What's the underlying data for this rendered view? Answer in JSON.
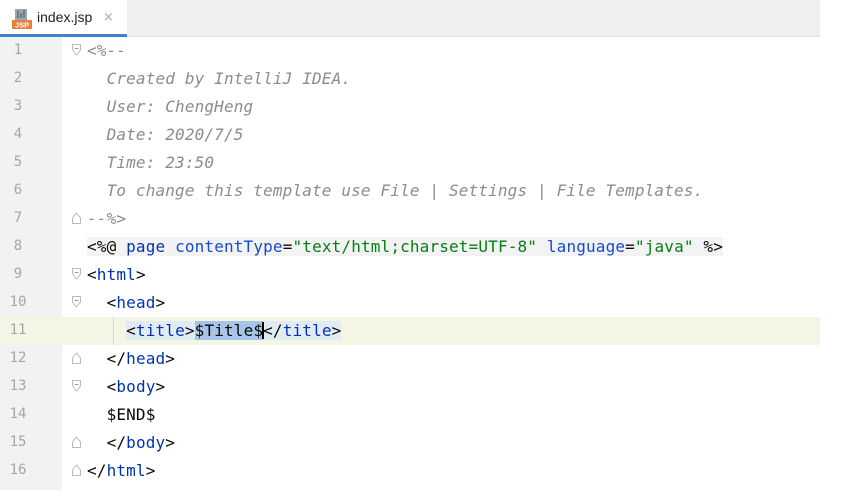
{
  "tab": {
    "file_name": "index.jsp",
    "icon_text": "JSP",
    "close_glyph": "×"
  },
  "editor": {
    "line_numbers": [
      "1",
      "2",
      "3",
      "4",
      "5",
      "6",
      "7",
      "8",
      "9",
      "10",
      "11",
      "12",
      "13",
      "14",
      "15",
      "16"
    ],
    "lines": {
      "l1": "<%--",
      "l2": "  Created by IntelliJ IDEA.",
      "l3": "  User: ChengHeng",
      "l4": "  Date: 2020/7/5",
      "l5": "  Time: 23:50",
      "l6": "  To change this template use File | Settings | File Templates.",
      "l7": "--%>",
      "l8": {
        "open": "<%@ ",
        "directive": "page",
        "sp1": " ",
        "attr1": "contentType",
        "eq1": "=",
        "val1": "\"text/html;charset=UTF-8\"",
        "sp2": " ",
        "attr2": "language",
        "eq2": "=",
        "val2": "\"java\"",
        "close": " %>"
      },
      "l9": {
        "lt": "<",
        "name": "html",
        "gt": ">"
      },
      "l10": {
        "indent": "  ",
        "lt": "<",
        "name": "head",
        "gt": ">"
      },
      "l11": {
        "indent": "    ",
        "open_lt": "<",
        "open_name": "title",
        "open_gt": ">",
        "var_left": "$Title$",
        "var_right": "",
        "close_lt": "</",
        "close_name": "title",
        "close_gt": ">"
      },
      "l12": {
        "indent": "  ",
        "lt": "</",
        "name": "head",
        "gt": ">"
      },
      "l13": {
        "indent": "  ",
        "lt": "<",
        "name": "body",
        "gt": ">"
      },
      "l14": "  $END$",
      "l15": {
        "indent": "  ",
        "lt": "</",
        "name": "body",
        "gt": ">"
      },
      "l16": {
        "lt": "</",
        "name": "html",
        "gt": ">"
      }
    }
  },
  "colors": {
    "comment": "#8c8c8c",
    "tag": "#0033b3",
    "attribute": "#174ad4",
    "string": "#067d17",
    "tab_underline": "#4083c9",
    "current_line": "#f5f5e6",
    "template_highlight": "#a6c5e8"
  }
}
